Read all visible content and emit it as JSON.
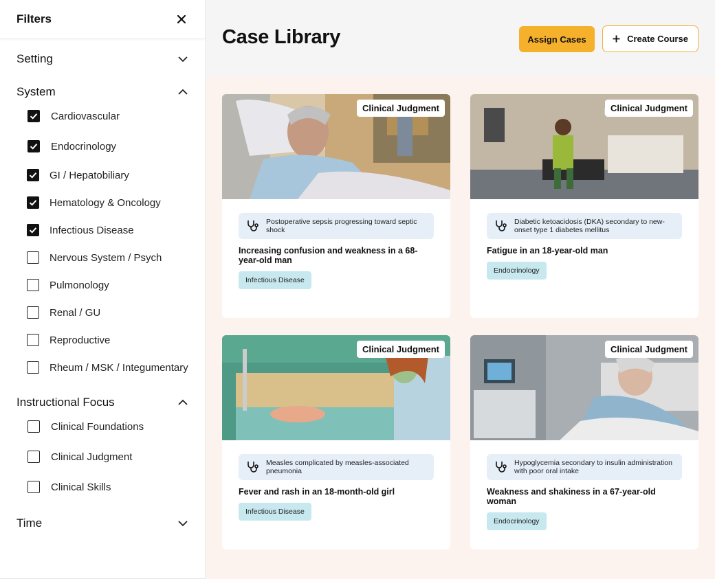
{
  "sidebar": {
    "title": "Filters",
    "sections": [
      {
        "title": "Setting",
        "expanded": false
      },
      {
        "title": "System",
        "expanded": true,
        "items": [
          {
            "label": "Cardiovascular",
            "checked": true
          },
          {
            "label": "Endocrinology",
            "checked": true
          },
          {
            "label": "GI / Hepatobiliary",
            "checked": true
          },
          {
            "label": "Hematology & Oncology",
            "checked": true
          },
          {
            "label": "Infectious Disease",
            "checked": true
          },
          {
            "label": "Nervous System / Psych",
            "checked": false
          },
          {
            "label": "Pulmonology",
            "checked": false
          },
          {
            "label": "Renal / GU",
            "checked": false
          },
          {
            "label": "Reproductive",
            "checked": false
          },
          {
            "label": "Rheum / MSK / Integumentary",
            "checked": false
          }
        ]
      },
      {
        "title": "Instructional Focus",
        "expanded": true,
        "items": [
          {
            "label": "Clinical Foundations",
            "checked": false
          },
          {
            "label": "Clinical Judgment",
            "checked": false
          },
          {
            "label": "Clinical Skills",
            "checked": false
          }
        ]
      },
      {
        "title": "Time",
        "expanded": false
      }
    ]
  },
  "header": {
    "title": "Case Library",
    "assign_label": "Assign Cases",
    "create_label": "Create Course"
  },
  "cards": [
    {
      "badge": "Clinical Judgment",
      "diagnosis": "Postoperative sepsis progressing toward septic shock",
      "title": "Increasing confusion and weakness in a 68-year-old man",
      "tag": "Infectious Disease"
    },
    {
      "badge": "Clinical Judgment",
      "diagnosis": "Diabetic ketoacidosis (DKA) secondary to new-onset type 1 diabetes mellitus",
      "title": "Fatigue in an 18-year-old man",
      "tag": "Endocrinology"
    },
    {
      "badge": "Clinical Judgment",
      "diagnosis": "Measles complicated by measles-associated pneumonia",
      "title": "Fever and rash in an 18-month-old girl",
      "tag": "Infectious Disease"
    },
    {
      "badge": "Clinical Judgment",
      "diagnosis": "Hypoglycemia secondary to insulin administration with poor oral intake",
      "title": "Weakness and shakiness in a 67-year-old woman",
      "tag": "Endocrinology"
    }
  ],
  "colors": {
    "accent": "#f6b12c",
    "content_bg": "#fdf3ee",
    "diag_bg": "#e6eef8",
    "tag_bg": "#c6e8ee"
  },
  "icons": {
    "close": "close-icon",
    "chevron": "chevron-icon",
    "check": "check-icon",
    "plus": "plus-icon",
    "stethoscope": "stethoscope-icon"
  }
}
